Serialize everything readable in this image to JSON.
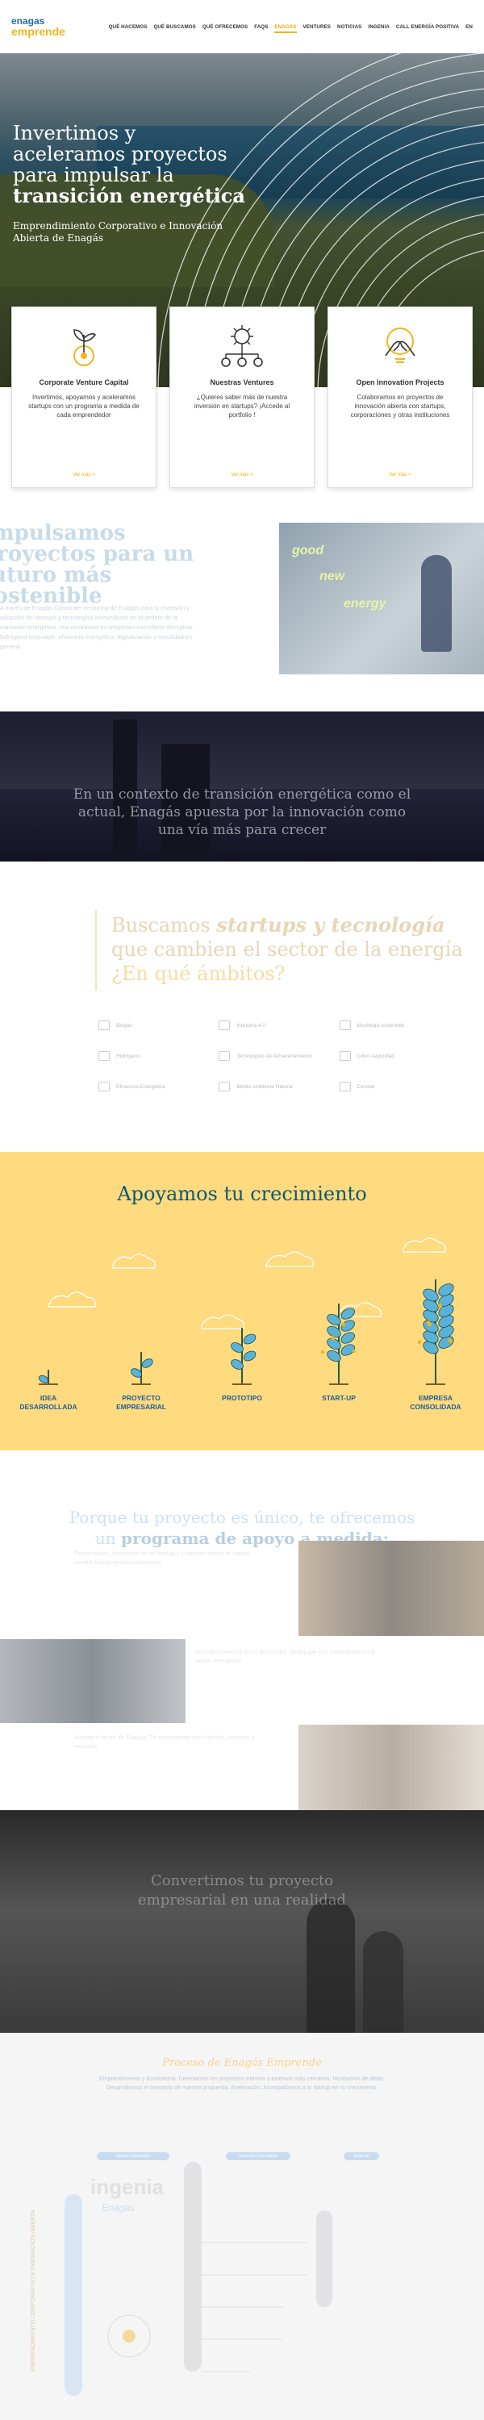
{
  "nav": {
    "logo_line1": "enagas",
    "logo_line2": "emprende",
    "items": [
      "QUÉ HACEMOS",
      "QUÉ BUSCAMOS",
      "QUÉ OFRECEMOS",
      "FAQS",
      "ENAGAS",
      "VENTURES",
      "NOTICIAS",
      "INGENIA",
      "CALL ENERGÍA POSITIVA",
      "EN"
    ],
    "active_index": 4
  },
  "hero": {
    "title_line1": "Invertimos y",
    "title_line2": "aceleramos proyectos",
    "title_line3": "para impulsar la",
    "title_bold": "transición energética",
    "subtitle": "Emprendimiento Corporativo e Innovación Abierta de Enagás"
  },
  "cards": [
    {
      "title": "Corporate Venture Capital",
      "text": "Invertimos, apoyamos y aceleramos startups con un programa a medida de cada emprendedor",
      "more": "Ver más  >",
      "icon": "sprout-icon"
    },
    {
      "title": "Nuestras Ventures",
      "text": "¿Quieres saber más de nuestra inversión en startups? ¡Accede al portfolio !",
      "more": "Ver más  >",
      "icon": "network-icon"
    },
    {
      "title": "Open Innovation Projects",
      "text": "Colaboramos en proyectos de innovación abierta con startups, corporaciones y otras instituciones",
      "more": "Ver más  >",
      "icon": "handshake-bulb-icon"
    }
  ],
  "impulsamos": {
    "heading": "Impulsamos proyectos para un futuro más sostenible",
    "paragraph": "A través de Enagás Corporate Venturing de Enagás para la inversión y adopción de startups y tecnologías innovadoras en el ámbito de la transición energética, nos centramos en proyectos con efecto disruptivo: hidrógeno renovable, eficiencia energética, digitalización y movilidad en general.",
    "image_words": [
      "good",
      "new",
      "energy"
    ]
  },
  "banner1": {
    "text": "En un contexto de transición energética como el actual, Enagás apuesta por la innovación como una vía más para crecer"
  },
  "buscamos": {
    "heading_plain1": "Buscamos ",
    "heading_italic": "startups y tecnología",
    "heading_plain2": " que cambien el sector de la energía ",
    "heading_yellow": "¿En qué ámbitos?",
    "areas": [
      "Biogás",
      "Industria 4.0",
      "Movilidad sostenible",
      "Hidrógeno",
      "Tecnologías de Almacenamiento",
      "Ciber-seguridad",
      "Eficiencia Energética",
      "Medio Ambiente Natural",
      "Circular"
    ]
  },
  "crecimiento": {
    "heading": "Apoyamos tu crecimiento",
    "stages": [
      "IDEA DESARROLLADA",
      "PROYECTO EMPRESARIAL",
      "PROTOTIPO",
      "START-UP",
      "EMPRESA CONSOLIDADA"
    ]
  },
  "programa": {
    "heading_line1": "Porque tu proyecto es único, te ofrecemos",
    "heading_plain": "un ",
    "heading_bold": "programa de apoyo a medida:",
    "block1": "Financiación. Invertimos en tu startup y cubrimos desde el capital semilla hasta rondas posteriores.",
    "block2": "Acompañamiento en tu desarrollo. Un equipo con experiencia en el sector energético.",
    "block3": "Acceso a la red de Enagás. Te conectamos con clientes, partners y expertos."
  },
  "banner2": {
    "text": "Convertimos tu proyecto empresarial en una realidad"
  },
  "proceso": {
    "heading": "Proceso de Enagás Emprende",
    "paragraph": "Emprendimiento y Ecosistema. Detectamos los proyectos internos y externos más cercanos. Incubación de ideas. Desarrollamos el concepto de nuestra propuesta. Aceleración. Acompañamos a tu startup en su crecimiento.",
    "pills": [
      "Apoyo Corporativo",
      "Inversión Corporativa",
      "Scale-up"
    ],
    "vertical_label": "EMPRENDIMIENTO CORPORATIVO E INNOVACIÓN ABIERTA",
    "ingenia_logo": "ingenia",
    "ingenia_sub": "Enagás"
  },
  "colors": {
    "accent": "#f2b51b",
    "brand_blue": "#1b6ca8",
    "teal": "#0c5a73",
    "grow_bg": "#ffda7e"
  }
}
